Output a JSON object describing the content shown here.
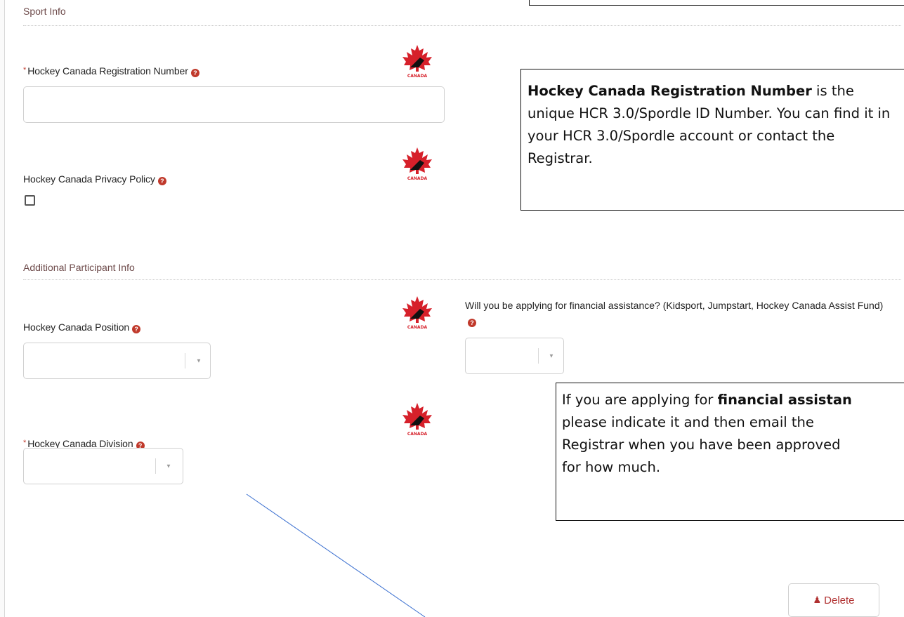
{
  "sections": {
    "sport_info": "Sport Info",
    "additional_info": "Additional Participant Info"
  },
  "fields": {
    "registration_number": {
      "label": "Hockey Canada Registration Number",
      "required": true,
      "value": "",
      "help": "?"
    },
    "privacy_policy": {
      "label": "Hockey Canada Privacy Policy",
      "help": "?",
      "checked": false
    },
    "position": {
      "label": "Hockey Canada Position",
      "help": "?",
      "value": ""
    },
    "financial_assistance": {
      "label": "Will you be applying for financial assistance? (Kidsport, Jumpstart, Hockey Canada Assist Fund)",
      "help": "?",
      "value": ""
    },
    "division": {
      "label": "Hockey Canada Division",
      "required": true,
      "help": "?",
      "value": ""
    }
  },
  "required_marker": "*",
  "logo": {
    "text": "CANADA",
    "icon": "hockey-canada-maple-leaf-logo",
    "color": "#d6202a"
  },
  "callouts": {
    "registration": {
      "bold": "Hockey Canada Registration Number",
      "rest": " is the unique HCR 3.0/Spordle ID Number. You can find it in your HCR 3.0/Spordle account or contact the Registrar."
    },
    "financial": {
      "line1_pre": "If you are applying for ",
      "line1_bold": "financial assistan",
      "line2": "please indicate it and then email the",
      "line3": "Registrar when you have been approved",
      "line4": "for how much."
    }
  },
  "actions": {
    "delete_label": "Delete",
    "delete_icon": "remove-user-icon"
  },
  "colors": {
    "accent": "#c0392b",
    "section_title": "#6d4a4a",
    "leader_line": "#3a6fd0"
  }
}
